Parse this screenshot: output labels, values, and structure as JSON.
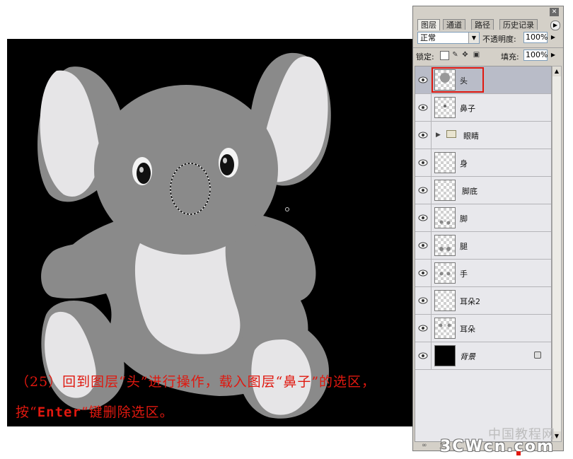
{
  "caption": {
    "line1": "（25）回到图层“头”进行操作，载入图层“鼻子”的选区，",
    "line2_a": "按“",
    "line2_key": "Enter",
    "line2_b": "”键删除选区。"
  },
  "panel": {
    "close_icon": "x-icon",
    "tabs": [
      {
        "label": "图层",
        "active": true
      },
      {
        "label": "通道",
        "active": false
      },
      {
        "label": "路径",
        "active": false
      },
      {
        "label": "历史记录",
        "active": false
      }
    ],
    "blend_mode": "正常",
    "opacity_label": "不透明度:",
    "opacity_value": "100%",
    "lock_label": "锁定:",
    "fill_label": "填充:",
    "fill_value": "100%",
    "layers": [
      {
        "name": "头",
        "selected": true,
        "type": "layer"
      },
      {
        "name": "鼻子",
        "selected": false,
        "type": "layer"
      },
      {
        "name": "眼睛",
        "selected": false,
        "type": "group"
      },
      {
        "name": "身",
        "selected": false,
        "type": "layer"
      },
      {
        "name": "脚底",
        "selected": false,
        "type": "layer"
      },
      {
        "name": "脚",
        "selected": false,
        "type": "layer"
      },
      {
        "name": "腿",
        "selected": false,
        "type": "layer"
      },
      {
        "name": "手",
        "selected": false,
        "type": "layer"
      },
      {
        "name": "耳朵2",
        "selected": false,
        "type": "layer"
      },
      {
        "name": "耳朵",
        "selected": false,
        "type": "layer"
      },
      {
        "name": "背景",
        "selected": false,
        "type": "background"
      }
    ]
  },
  "watermark": {
    "line1": "中国教程网",
    "line2": "3CWcn.com"
  },
  "colors": {
    "canvas_bg": "#000000",
    "koala_gray": "#8a8a8a",
    "koala_light": "#e6e5e7",
    "caption_red": "#e0180f",
    "selected_layer": "#b9bcc8"
  }
}
